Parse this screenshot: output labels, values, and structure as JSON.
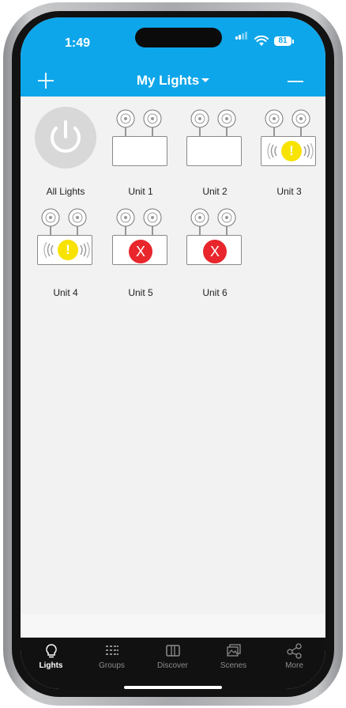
{
  "status_bar": {
    "time": "1:49",
    "battery": "81"
  },
  "header": {
    "title": "My Lights"
  },
  "tiles": [
    {
      "label": "All Lights",
      "kind": "power"
    },
    {
      "label": "Unit 1",
      "kind": "fixture",
      "state": "ok"
    },
    {
      "label": "Unit 2",
      "kind": "fixture",
      "state": "ok"
    },
    {
      "label": "Unit 3",
      "kind": "fixture",
      "state": "warning",
      "badge": "!"
    },
    {
      "label": "Unit 4",
      "kind": "fixture",
      "state": "warning",
      "badge": "!"
    },
    {
      "label": "Unit 5",
      "kind": "fixture",
      "state": "error",
      "badge": "X"
    },
    {
      "label": "Unit 6",
      "kind": "fixture",
      "state": "error",
      "badge": "X"
    }
  ],
  "tabbar": {
    "active": "lights",
    "tabs": [
      {
        "id": "lights",
        "label": "Lights",
        "icon": "lightbulb-icon"
      },
      {
        "id": "groups",
        "label": "Groups",
        "icon": "groups-grid-icon"
      },
      {
        "id": "discover",
        "label": "Discover",
        "icon": "discover-icon"
      },
      {
        "id": "scenes",
        "label": "Scenes",
        "icon": "scenes-icon"
      },
      {
        "id": "more",
        "label": "More",
        "icon": "share-icon"
      }
    ]
  },
  "colors": {
    "header": "#0ea6ea",
    "warning": "#f7e200",
    "error": "#e8262c",
    "tabbar": "#111111"
  }
}
